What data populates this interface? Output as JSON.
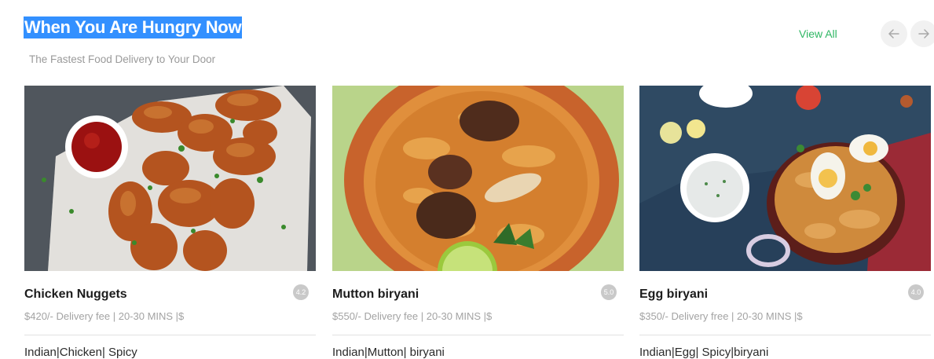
{
  "header": {
    "title": "When You Are Hungry Now",
    "subtitle": "The Fastest Food Delivery to Your Door",
    "view_all": "View All",
    "prev_icon": "arrow-left-icon",
    "next_icon": "arrow-right-icon"
  },
  "cards": [
    {
      "title": "Chicken Nuggets",
      "rating": "4.2",
      "meta": "$420/- Delivery fee | 20-30 MINS |$",
      "tags": "Indian|Chicken| Spicy",
      "image": "chicken-wings-photo"
    },
    {
      "title": "Mutton biryani",
      "rating": "5.0",
      "meta": "$550/- Delivery fee | 20-30 MINS |$",
      "tags": "Indian|Mutton| biryani",
      "image": "mutton-biryani-photo"
    },
    {
      "title": "Egg biryani",
      "rating": "4.0",
      "meta": "$350/- Delivery free | 20-30 MINS |$",
      "tags": "Indian|Egg| Spicy|biryani",
      "image": "egg-biryani-photo"
    }
  ],
  "colors": {
    "accent_green": "#2fb764",
    "title_highlight": "#3390ff",
    "rating_badge": "#c9c9c9",
    "subtitle_gray": "#9a9a9a"
  }
}
